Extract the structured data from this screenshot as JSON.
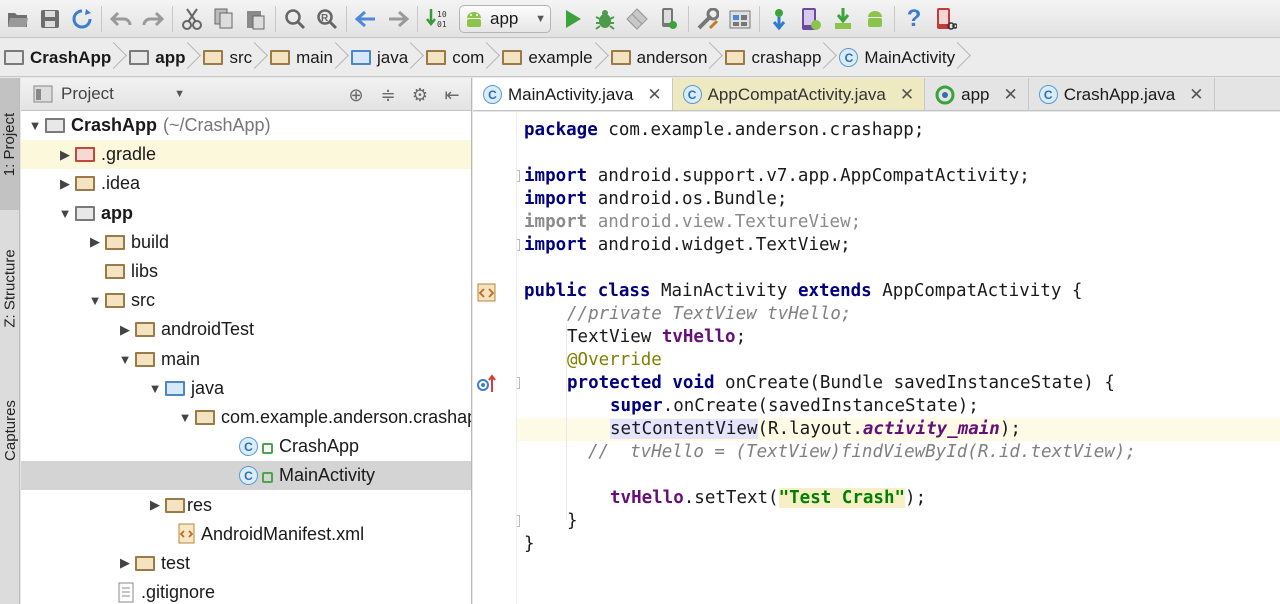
{
  "toolbar": {
    "run_config": "app",
    "icons": [
      "folder-open-icon",
      "save-icon",
      "sync-icon",
      "undo-icon",
      "redo-icon",
      "cut-icon",
      "copy-icon",
      "paste-icon",
      "find-icon",
      "replace-icon",
      "back-icon",
      "forward-icon",
      "make-project-icon",
      "run-icon",
      "debug-icon",
      "coverage-icon",
      "attach-debugger-icon",
      "project-structure-icon",
      "sdk-manager-icon",
      "avd-manager-icon",
      "sync-gradle-icon",
      "android-monitor-icon",
      "help-icon",
      "device-icon"
    ]
  },
  "breadcrumb": [
    {
      "label": "CrashApp",
      "bold": true,
      "icon": "module-folder-icon"
    },
    {
      "label": "app",
      "bold": true,
      "icon": "module-folder-icon"
    },
    {
      "label": "src",
      "icon": "folder-icon"
    },
    {
      "label": "main",
      "icon": "folder-icon"
    },
    {
      "label": "java",
      "icon": "source-folder-icon"
    },
    {
      "label": "com",
      "icon": "package-icon"
    },
    {
      "label": "example",
      "icon": "package-icon"
    },
    {
      "label": "anderson",
      "icon": "package-icon"
    },
    {
      "label": "crashapp",
      "icon": "package-icon"
    },
    {
      "label": "MainActivity",
      "icon": "class-icon"
    }
  ],
  "stripe": {
    "project_tab": "1: Project",
    "structure_tab": "Z: Structure",
    "captures_tab": "Captures"
  },
  "project_panel": {
    "view_label": "Project",
    "tree": {
      "root_name": "CrashApp",
      "root_path": "(~/CrashApp)",
      "gradle": ".gradle",
      "idea": ".idea",
      "app": "app",
      "build": "build",
      "libs": "libs",
      "src": "src",
      "android_test": "androidTest",
      "main": "main",
      "java": "java",
      "package": "com.example.anderson.crashapp",
      "crash_app": "CrashApp",
      "main_activity": "MainActivity",
      "res": "res",
      "manifest": "AndroidManifest.xml",
      "test": "test",
      "gitignore": ".gitignore"
    }
  },
  "editor": {
    "tabs": [
      {
        "label": "MainActivity.java",
        "icon": "class-icon",
        "active": true
      },
      {
        "label": "AppCompatActivity.java",
        "icon": "class-icon"
      },
      {
        "label": "app",
        "icon": "gradle-icon"
      },
      {
        "label": "CrashApp.java",
        "icon": "class-icon"
      }
    ],
    "code": {
      "package_kw": "package",
      "package_name": " com.example.anderson.crashapp;",
      "import_kw": "import",
      "import1": " android.support.v7.app.AppCompatActivity;",
      "import2": " android.os.Bundle;",
      "import3": " android.view.TextureView;",
      "import4": " android.widget.TextView;",
      "public_kw": "public",
      "class_kw": " class",
      "class_name": " MainActivity ",
      "extends_kw": "extends",
      "super_class": " AppCompatActivity {",
      "comment_field": "//private TextView tvHello;",
      "field_type": "TextView ",
      "field_name": "tvHello",
      "semicolon": ";",
      "annotation": "@Override",
      "protected_kw": "protected",
      "void_kw": " void",
      "on_create_sig": " onCreate(Bundle savedInstanceState) {",
      "super_kw": "super",
      "super_call": ".onCreate(savedInstanceState);",
      "set_content_view": "setContentView",
      "r_layout": "(R.layout.",
      "activity_main": "activity_main",
      "close_paren": ");",
      "commented_find": "//  tvHello = (TextView)findViewById(R.id.textView);",
      "tv_hello": "tvHello",
      "set_text": ".setText(",
      "test_crash": "\"Test Crash\"",
      "close_method": "}",
      "close_class": "}"
    }
  }
}
